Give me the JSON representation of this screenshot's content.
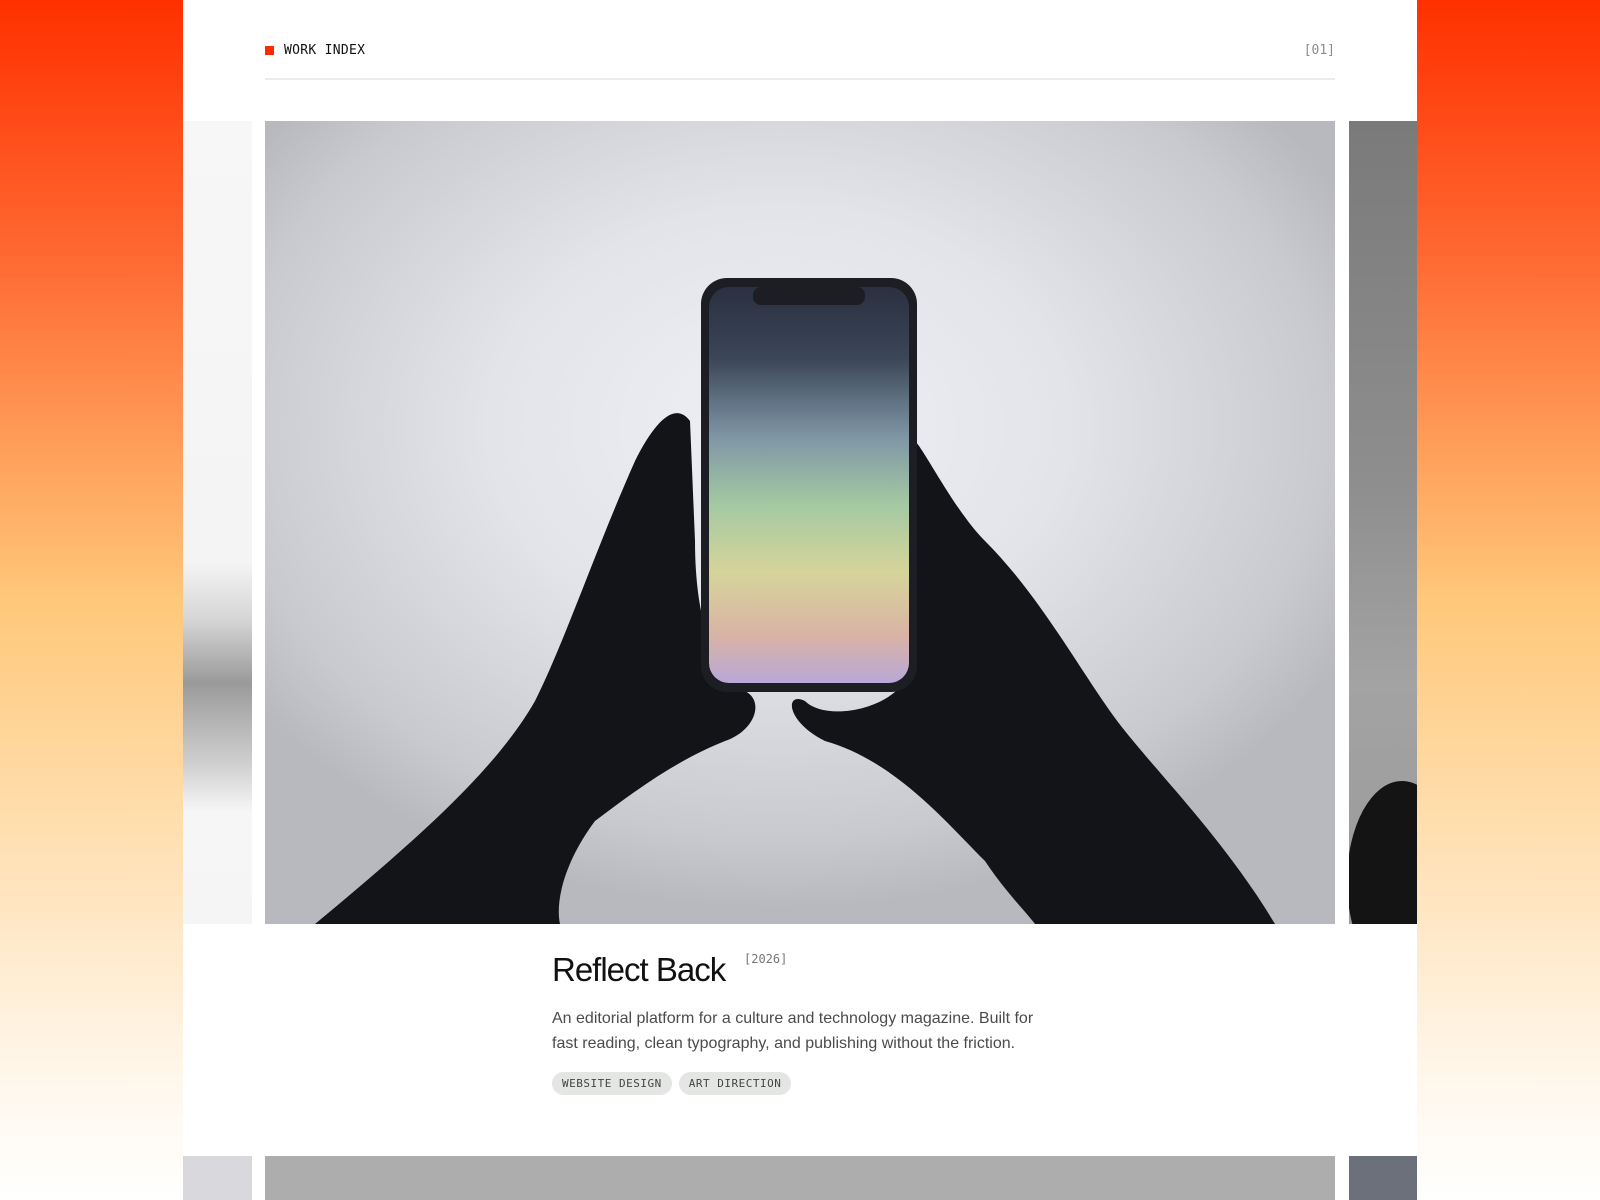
{
  "header": {
    "label": "WORK INDEX",
    "counter": "[01]",
    "accent_color": "#ff2a00"
  },
  "project": {
    "title": "Reflect Back",
    "year": "[2026]",
    "description": "An editorial platform for a culture and technology magazine. Built for fast reading, clean typography, and publishing without the friction.",
    "tags": [
      "WEBSITE DESIGN",
      "ART DIRECTION"
    ],
    "image_subject": "hands-holding-phone"
  }
}
